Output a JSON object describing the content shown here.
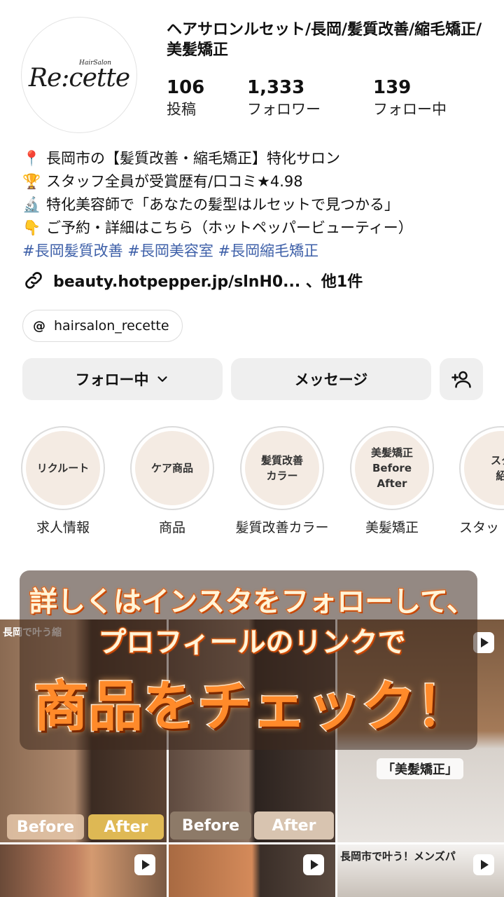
{
  "profile": {
    "logo_small": "HairSalon",
    "logo_main": "Re:cette",
    "title": "ヘアサロンルセット/長岡/髪質改善/縮毛矯正/美髪矯正",
    "stats": [
      {
        "value": "106",
        "label": "投稿"
      },
      {
        "value": "1,333",
        "label": "フォロワー"
      },
      {
        "value": "139",
        "label": "フォロー中"
      }
    ]
  },
  "bio": {
    "lines": [
      {
        "icon": "📍",
        "text": "長岡市の【髪質改善・縮毛矯正】特化サロン"
      },
      {
        "icon": "🏆",
        "text": "スタッフ全員が受賞歴有/口コミ★4.98"
      },
      {
        "icon": "🔬",
        "text": "特化美容師で「あなたの髪型はルセットで見つかる」"
      },
      {
        "icon": "👇",
        "text": "ご予約・詳細はこちら（ホットペッパービューティー）"
      }
    ],
    "hashtags": "#長岡髪質改善 #長岡美容室 #長岡縮毛矯正",
    "link": "beauty.hotpepper.jp/slnH0... 、他1件",
    "threads_handle": "hairsalon_recette"
  },
  "buttons": {
    "follow": "フォロー中",
    "message": "メッセージ"
  },
  "highlights": [
    {
      "inner": "リクルート",
      "caption": "求人情報"
    },
    {
      "inner": "ケア商品",
      "caption": "商品"
    },
    {
      "inner": "髪質改善\nカラー",
      "caption": "髪質改善カラー"
    },
    {
      "inner": "美髪矯正\nBefore\nAfter",
      "caption": "美髪矯正"
    },
    {
      "inner": "スタ\n紹",
      "caption": "スタッ"
    }
  ],
  "grid": {
    "tile1_caption": "長岡で叶う縮",
    "tile1_before": "Before",
    "tile1_after": "After",
    "tile2_before": "Before",
    "tile2_after": "After",
    "tile3_tag": "「美髪矯正」",
    "tile6_caption": "長岡市で叶う！メンズパ"
  },
  "overlay": {
    "line1": "詳しくはインスタをフォローして、",
    "line2": "プロフィールのリンクで",
    "line3": "商品をチェック！"
  }
}
